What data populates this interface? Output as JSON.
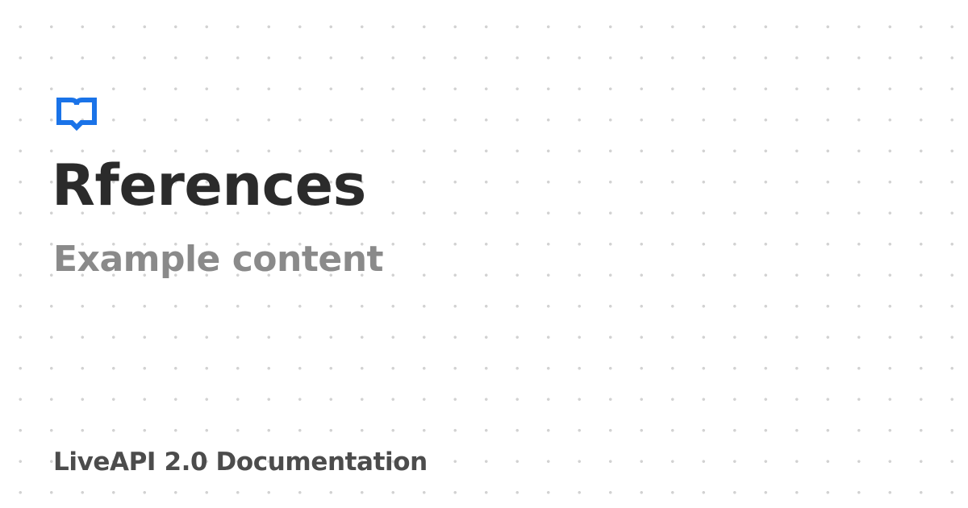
{
  "brand": {
    "icon": "book-icon",
    "accent_color": "#1a73e8"
  },
  "page": {
    "title": "Rferences",
    "subtitle": "Example content"
  },
  "footer": {
    "label": "LiveAPI 2.0 Documentation"
  },
  "colors": {
    "title": "#2b2b2b",
    "subtitle": "#8a8a8a",
    "footer": "#4c4c4c",
    "dot": "#d2d2d2"
  }
}
